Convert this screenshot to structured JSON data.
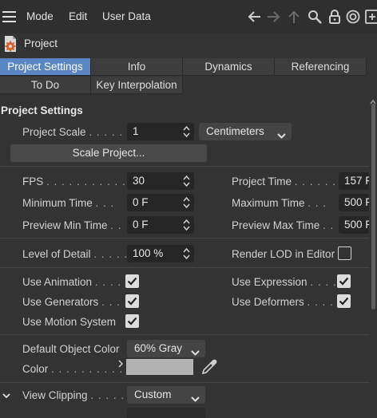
{
  "menu": {
    "mode": "Mode",
    "edit": "Edit",
    "user_data": "User Data"
  },
  "object": {
    "title": "Project"
  },
  "tabs": [
    {
      "label": "Project Settings",
      "active": true
    },
    {
      "label": "Info",
      "active": false
    },
    {
      "label": "Dynamics",
      "active": false
    },
    {
      "label": "Referencing",
      "active": false
    },
    {
      "label": "To Do",
      "active": false
    },
    {
      "label": "Key Interpolation",
      "active": false
    }
  ],
  "section": {
    "title": "Project Settings"
  },
  "project_scale": {
    "label": "Project Scale",
    "dots": ". . . . . .",
    "value": "1",
    "unit": "Centimeters"
  },
  "scale_button": "Scale Project...",
  "fps": {
    "label": "FPS",
    "dots": ". . . . . . . . . . . . .",
    "value": "30"
  },
  "project_time": {
    "label": "Project Time",
    "dots": ". . . . . .",
    "value": "157 F"
  },
  "min_time": {
    "label": "Minimum Time",
    "dots": ". . .",
    "value": "0 F"
  },
  "max_time": {
    "label": "Maximum Time",
    "dots": ". . .",
    "value": "500 F"
  },
  "preview_min": {
    "label": "Preview Min Time",
    "dots": ". .",
    "value": "0 F"
  },
  "preview_max": {
    "label": "Preview Max Time",
    "dots": ". .",
    "value": "500 F"
  },
  "lod": {
    "label": "Level of Detail",
    "dots": ". . . . .",
    "value": "100 %"
  },
  "render_lod": {
    "label": "Render LOD in Editor",
    "checked": false
  },
  "use_animation": {
    "label": "Use Animation",
    "dots": ". . . . .",
    "checked": true
  },
  "use_expression": {
    "label": "Use Expression",
    "dots": ". . . . .",
    "checked": true
  },
  "use_generators": {
    "label": "Use Generators",
    "dots": ". . . .",
    "checked": true
  },
  "use_deformers": {
    "label": "Use Deformers",
    "dots": ". . . . .",
    "checked": true
  },
  "use_motion": {
    "label": "Use Motion System",
    "checked": true
  },
  "default_color": {
    "label": "Default Object Color",
    "value": "60% Gray"
  },
  "color": {
    "label": "Color",
    "dots": ". . . . . . . . . . . . .",
    "swatch": "#b3b3b3"
  },
  "view_clipping": {
    "label": "View Clipping",
    "dots": ". . . . . .",
    "value": "Custom"
  },
  "colors": {
    "accent": "#5b86c4",
    "bg": "#333333",
    "field": "#262626"
  }
}
